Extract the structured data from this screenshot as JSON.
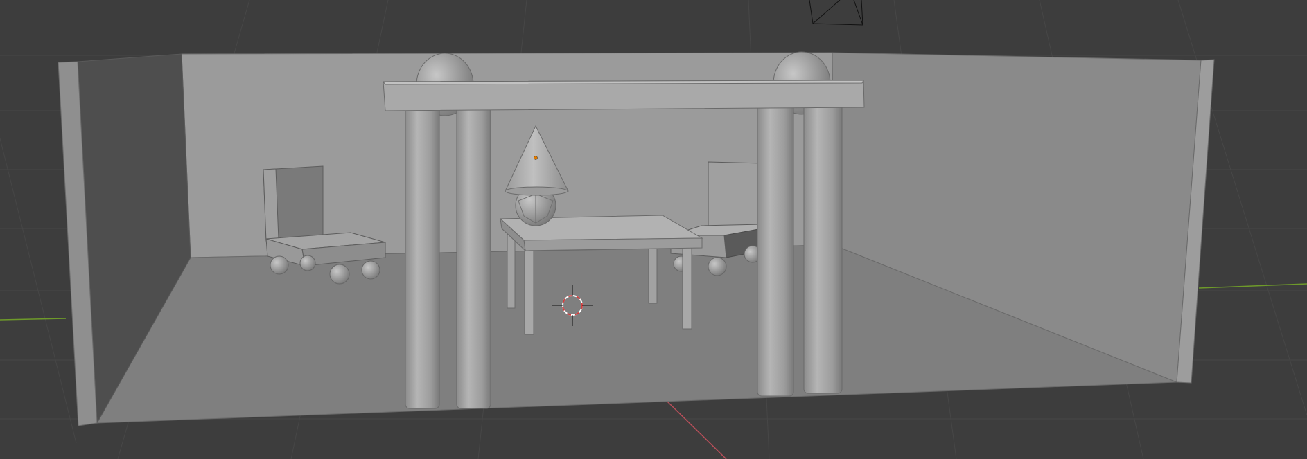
{
  "viewport": {
    "background_color": "#3d3d3d",
    "grid_color": "#4a4a4a",
    "axis_x_color": "#b94f5a",
    "axis_y_color": "#6e9a2a"
  },
  "scene": {
    "objects": [
      "left-wall",
      "back-wall",
      "right-wall",
      "floor",
      "left-chair",
      "right-chair",
      "table",
      "lamp-sphere",
      "lamp-cone",
      "gate-crossbeam",
      "gate-column",
      "gate-dome",
      "camera"
    ],
    "colors": {
      "wall": "#9a9a9a",
      "floor": "#7e7e7e",
      "shadow": "#555555",
      "object": "#a8a8a8",
      "edge": "#6a6a6a",
      "origin": "#e07a00",
      "cursor_red": "#d33f3f"
    }
  },
  "tools": {
    "cursor_icon": "3d-cursor-icon",
    "camera_icon": "camera-icon",
    "origin_icon": "object-origin-icon"
  }
}
